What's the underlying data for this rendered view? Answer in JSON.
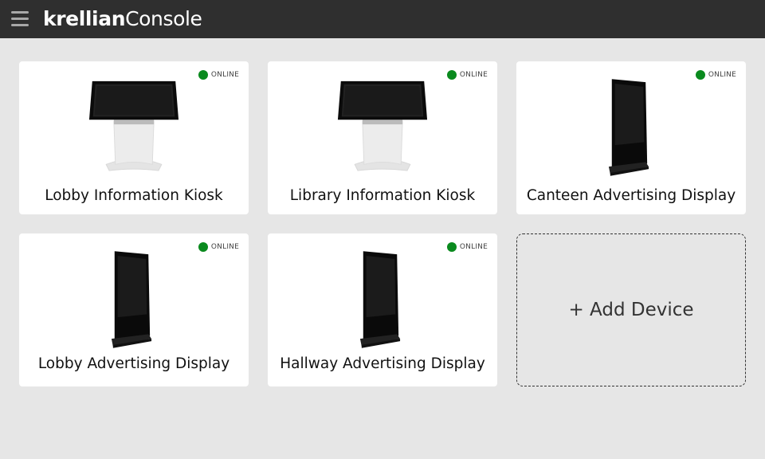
{
  "app": {
    "brand_bold": "krellian",
    "brand_light": "Console"
  },
  "colors": {
    "topbar": "#2f2f2f",
    "background": "#e6e6e6",
    "card": "#ffffff",
    "online": "#0a8a1e"
  },
  "devices": [
    {
      "name": "Lobby Information Kiosk",
      "status": "ONLINE",
      "type": "kiosk-icon"
    },
    {
      "name": "Library Information Kiosk",
      "status": "ONLINE",
      "type": "kiosk-icon"
    },
    {
      "name": "Canteen Advertising Display",
      "status": "ONLINE",
      "type": "totem-display-icon"
    },
    {
      "name": "Lobby Advertising Display",
      "status": "ONLINE",
      "type": "totem-display-icon"
    },
    {
      "name": "Hallway Advertising Display",
      "status": "ONLINE",
      "type": "totem-display-icon"
    }
  ],
  "add_device": {
    "label": "+ Add Device"
  }
}
